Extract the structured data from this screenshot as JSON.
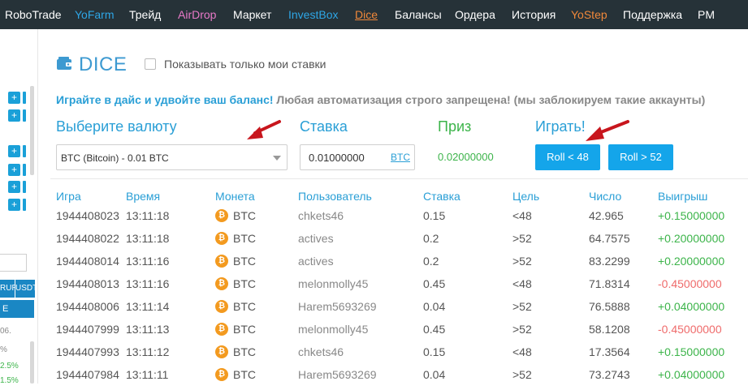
{
  "nav": {
    "items": [
      {
        "label": "RoboTrade",
        "style": "white"
      },
      {
        "label": "YoFarm",
        "style": "blue"
      },
      {
        "label": "Трейд",
        "style": "white"
      },
      {
        "label": "AirDrop",
        "style": "pink"
      },
      {
        "label": "Маркет",
        "style": "white"
      },
      {
        "label": "InvestBox",
        "style": "blue"
      },
      {
        "label": "Dice",
        "style": "dice"
      },
      {
        "label": "Балансы",
        "style": "white"
      },
      {
        "label": "Ордера",
        "style": "white"
      },
      {
        "label": "История",
        "style": "white"
      },
      {
        "label": "YoStep",
        "style": "orange"
      },
      {
        "label": "Поддержка",
        "style": "white"
      },
      {
        "label": "PM",
        "style": "white"
      }
    ],
    "background": "#263238"
  },
  "sidebar": {
    "plus_label": "+",
    "currency_tabs": [
      "RUR",
      "USDT"
    ],
    "e_label": "E",
    "texts": [
      "06.",
      "%",
      "2.5%",
      "1.5%"
    ]
  },
  "page": {
    "title": "DICE",
    "only_mine_label": "Показывать только мои ставки",
    "promo_highlight": "Играйте в дайс и удвойте ваш баланс!",
    "promo_rest": " Любая автоматизация строго запрещена! (мы заблокируем такие аккаунты)"
  },
  "form": {
    "currency_label": "Выберите валюту",
    "currency_value": "BTC (Bitcoin) - 0.01 BTC",
    "stake_label": "Ставка",
    "stake_value": "0.01000000",
    "stake_currency": "BTC",
    "prize_label": "Приз",
    "prize_value": "0.02000000",
    "play_label": "Играть!",
    "roll_low_label": "Roll < 48",
    "roll_high_label": "Roll > 52"
  },
  "table": {
    "headers": [
      "Игра",
      "Время",
      "Монета",
      "Пользователь",
      "Ставка",
      "Цель",
      "Число",
      "Выигрыш"
    ],
    "rows": [
      {
        "game": "1944408023",
        "time": "13:11:18",
        "coin": "BTC",
        "user": "chkets46",
        "stake": "0.15",
        "target": "<48",
        "number": "42.965",
        "win": "+0.15000000",
        "positive": true
      },
      {
        "game": "1944408022",
        "time": "13:11:18",
        "coin": "BTC",
        "user": "actives",
        "stake": "0.2",
        "target": ">52",
        "number": "64.7575",
        "win": "+0.20000000",
        "positive": true
      },
      {
        "game": "1944408014",
        "time": "13:11:16",
        "coin": "BTC",
        "user": "actives",
        "stake": "0.2",
        "target": ">52",
        "number": "83.2299",
        "win": "+0.20000000",
        "positive": true
      },
      {
        "game": "1944408013",
        "time": "13:11:16",
        "coin": "BTC",
        "user": "melonmolly45",
        "stake": "0.45",
        "target": "<48",
        "number": "71.8314",
        "win": "-0.45000000",
        "positive": false
      },
      {
        "game": "1944408006",
        "time": "13:11:14",
        "coin": "BTC",
        "user": "Harem5693269",
        "stake": "0.04",
        "target": ">52",
        "number": "76.5888",
        "win": "+0.04000000",
        "positive": true
      },
      {
        "game": "1944407999",
        "time": "13:11:13",
        "coin": "BTC",
        "user": "melonmolly45",
        "stake": "0.45",
        "target": ">52",
        "number": "58.1208",
        "win": "-0.45000000",
        "positive": false
      },
      {
        "game": "1944407993",
        "time": "13:11:12",
        "coin": "BTC",
        "user": "chkets46",
        "stake": "0.15",
        "target": "<48",
        "number": "17.3564",
        "win": "+0.15000000",
        "positive": true
      },
      {
        "game": "1944407984",
        "time": "13:11:11",
        "coin": "BTC",
        "user": "Harem5693269",
        "stake": "0.04",
        "target": ">52",
        "number": "73.2743",
        "win": "+0.04000000",
        "positive": true
      }
    ]
  },
  "colors": {
    "accent": "#2a9fd6",
    "button": "#14a5ea",
    "positive": "#3cb44a",
    "negative": "#ef6b6b",
    "coin": "#f39a1f",
    "arrow": "#c8161d"
  }
}
